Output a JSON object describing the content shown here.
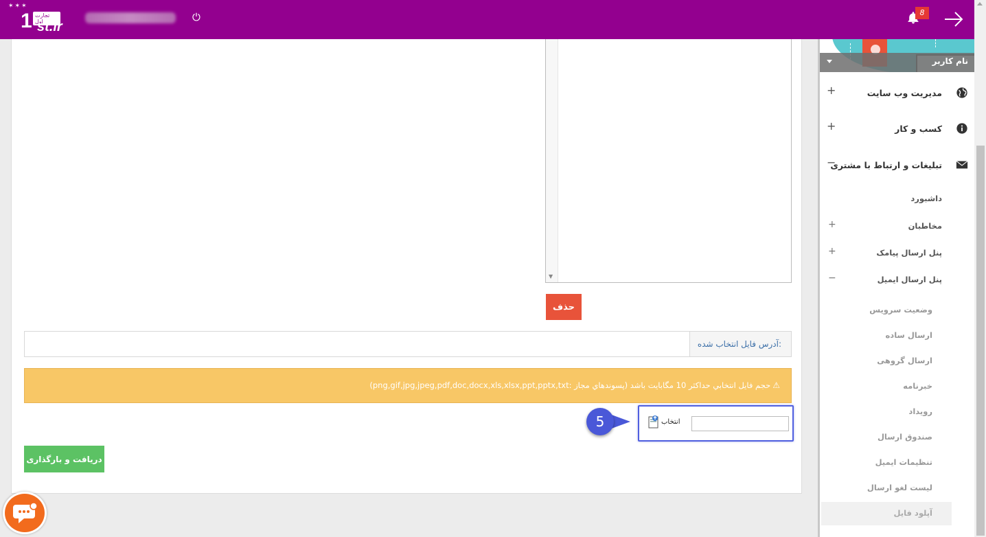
{
  "header": {
    "logo_number": "1",
    "logo_domain": "st.ir",
    "logo_tag": "تجارت اول",
    "bell_badge": "8"
  },
  "sidebar": {
    "user_name": "نام کاربر",
    "items": [
      {
        "label": "مدیریت وب سایت",
        "toggle": "+",
        "icon": "globe-icon"
      },
      {
        "label": "کسب و کار",
        "toggle": "+",
        "icon": "info-icon"
      },
      {
        "label": "تبلیغات و ارتباط با مشتری",
        "toggle": "−",
        "icon": "envelope-icon"
      }
    ],
    "subitems": [
      {
        "label": "داشبورد",
        "toggle": ""
      },
      {
        "label": "مخاطبان",
        "toggle": "+"
      },
      {
        "label": "پنل ارسال پیامک",
        "toggle": "+"
      },
      {
        "label": "پنل ارسال ایمیل",
        "toggle": "−"
      }
    ],
    "email_items": [
      {
        "label": "وضعیت سرویس"
      },
      {
        "label": "ارسال ساده"
      },
      {
        "label": "ارسال گروهی"
      },
      {
        "label": "خبرنامه"
      },
      {
        "label": "رویداد"
      },
      {
        "label": "صندوق ارسال"
      },
      {
        "label": "تنظیمات ایمیل"
      },
      {
        "label": "لیست لغو ارسال"
      },
      {
        "label": "آپلود فایل"
      }
    ]
  },
  "main": {
    "delete_label": "حذف",
    "address_label": "آدرس فایل انتخاب شده:",
    "address_value": "",
    "warning_text": "حجم فایل انتخابي حداکثر 10 مگابایت باشد (پسوندهاي مجاز :png,gif,jpg,jpeg,pdf,doc,docx,xls,xlsx,ppt,pptx,txt)",
    "choose_label": "انتخاب",
    "file_value": "",
    "step_number": "5",
    "upload_label": "دریافت و بارگذاری"
  },
  "colors": {
    "header": "#93008f",
    "delete": "#e8533a",
    "warning": "#f8c766",
    "upload": "#5cc264",
    "step": "#4a58d8",
    "chat": "#f26b1d"
  }
}
